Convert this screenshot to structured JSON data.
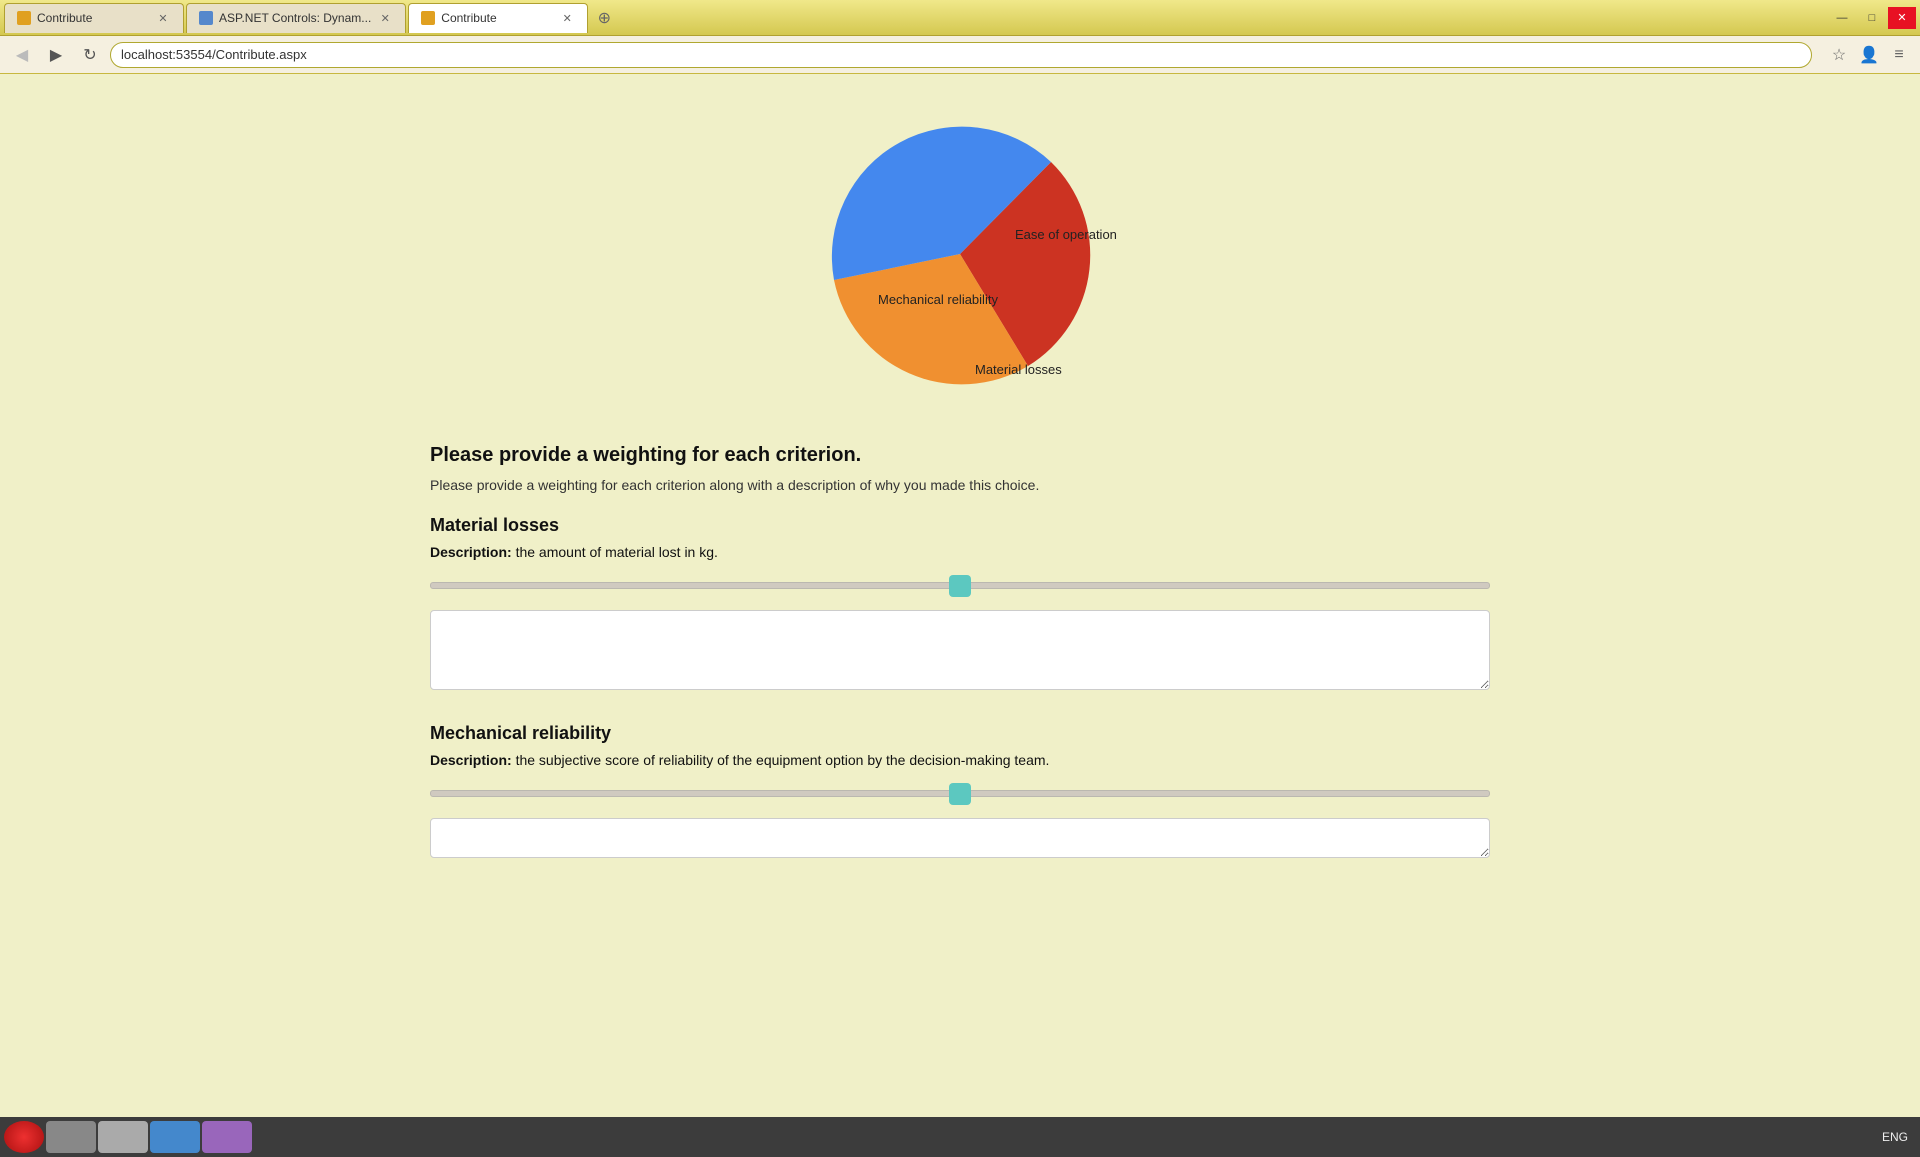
{
  "browser": {
    "tabs": [
      {
        "id": "tab1",
        "label": "Contribute",
        "active": false,
        "url": "localhost:53554/Contribute.aspx"
      },
      {
        "id": "tab2",
        "label": "ASP.NET Controls: Dynam...",
        "active": false,
        "url": ""
      },
      {
        "id": "tab3",
        "label": "Contribute",
        "active": true,
        "url": "localhost:53554/Contribute.aspx"
      }
    ],
    "address": "localhost:53554/Contribute.aspx"
  },
  "page": {
    "main_heading": "Please provide a weighting for each criterion.",
    "main_subtext": "Please provide a weighting for each criterion along with a description of why you made this choice.",
    "criteria": [
      {
        "name": "Material losses",
        "description": "the amount of material lost in kg.",
        "slider_value": 50,
        "textarea_placeholder": ""
      },
      {
        "name": "Mechanical reliability",
        "description": "the subjective score of reliability of the equipment option by the decision-making team.",
        "slider_value": 50,
        "textarea_placeholder": ""
      }
    ]
  },
  "pie_chart": {
    "segments": [
      {
        "label": "Ease of operation",
        "color": "#cc3322",
        "percentage": 28
      },
      {
        "label": "Mechanical reliability",
        "color": "#f09030",
        "percentage": 38
      },
      {
        "label": "Material losses",
        "color": "#4488ee",
        "percentage": 34
      }
    ]
  },
  "taskbar": {
    "time": "ENG"
  },
  "icons": {
    "back": "◀",
    "forward": "▶",
    "refresh": "↻",
    "star": "☆",
    "person": "👤",
    "menu": "≡",
    "minimize": "—",
    "maximize": "□",
    "close": "✕"
  }
}
